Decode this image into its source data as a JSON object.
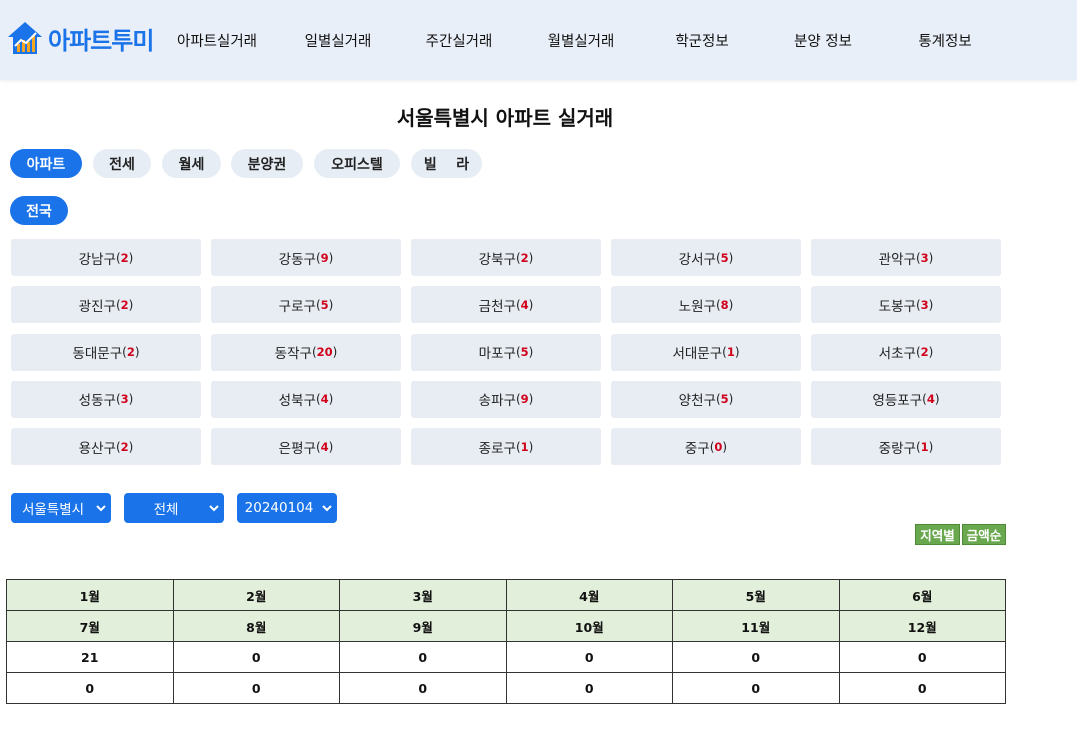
{
  "header": {
    "logo_text": "아파트투미",
    "nav": [
      "아파트실거래",
      "일별실거래",
      "주간실거래",
      "월별실거래",
      "학군정보",
      "분양 정보",
      "통계정보"
    ]
  },
  "page_title": "서울특별시 아파트 실거래",
  "type_tabs": [
    "아파트",
    "전세",
    "월세",
    "분양권",
    "오피스텔",
    "빌    라"
  ],
  "region_tab": "전국",
  "districts": [
    {
      "name": "강남구",
      "count": "2"
    },
    {
      "name": "강동구",
      "count": "9"
    },
    {
      "name": "강북구",
      "count": "2"
    },
    {
      "name": "강서구",
      "count": "5"
    },
    {
      "name": "관악구",
      "count": "3"
    },
    {
      "name": "광진구",
      "count": "2"
    },
    {
      "name": "구로구",
      "count": "5"
    },
    {
      "name": "금천구",
      "count": "4"
    },
    {
      "name": "노원구",
      "count": "8"
    },
    {
      "name": "도봉구",
      "count": "3"
    },
    {
      "name": "동대문구",
      "count": "2"
    },
    {
      "name": "동작구",
      "count": "20"
    },
    {
      "name": "마포구",
      "count": "5"
    },
    {
      "name": "서대문구",
      "count": "1"
    },
    {
      "name": "서초구",
      "count": "2"
    },
    {
      "name": "성동구",
      "count": "3"
    },
    {
      "name": "성북구",
      "count": "4"
    },
    {
      "name": "송파구",
      "count": "9"
    },
    {
      "name": "양천구",
      "count": "5"
    },
    {
      "name": "영등포구",
      "count": "4"
    },
    {
      "name": "용산구",
      "count": "2"
    },
    {
      "name": "은평구",
      "count": "4"
    },
    {
      "name": "종로구",
      "count": "1"
    },
    {
      "name": "중구",
      "count": "0"
    },
    {
      "name": "중랑구",
      "count": "1"
    }
  ],
  "filters": {
    "city": "서울특별시",
    "district": "전체",
    "date": "20240104"
  },
  "sort_buttons": [
    "지역별",
    "금액순"
  ],
  "months_table": {
    "row1_labels": [
      "1월",
      "2월",
      "3월",
      "4월",
      "5월",
      "6월"
    ],
    "row2_labels": [
      "7월",
      "8월",
      "9월",
      "10월",
      "11월",
      "12월"
    ],
    "row1_values": [
      "21",
      "0",
      "0",
      "0",
      "0",
      "0"
    ],
    "row2_values": [
      "0",
      "0",
      "0",
      "0",
      "0",
      "0"
    ]
  },
  "colors": {
    "accent": "#1a73e8",
    "header_bg": "#e9eff8",
    "count_red": "#d0021b",
    "sort_green": "#6aa84f",
    "table_header_bg": "#e2efda"
  }
}
